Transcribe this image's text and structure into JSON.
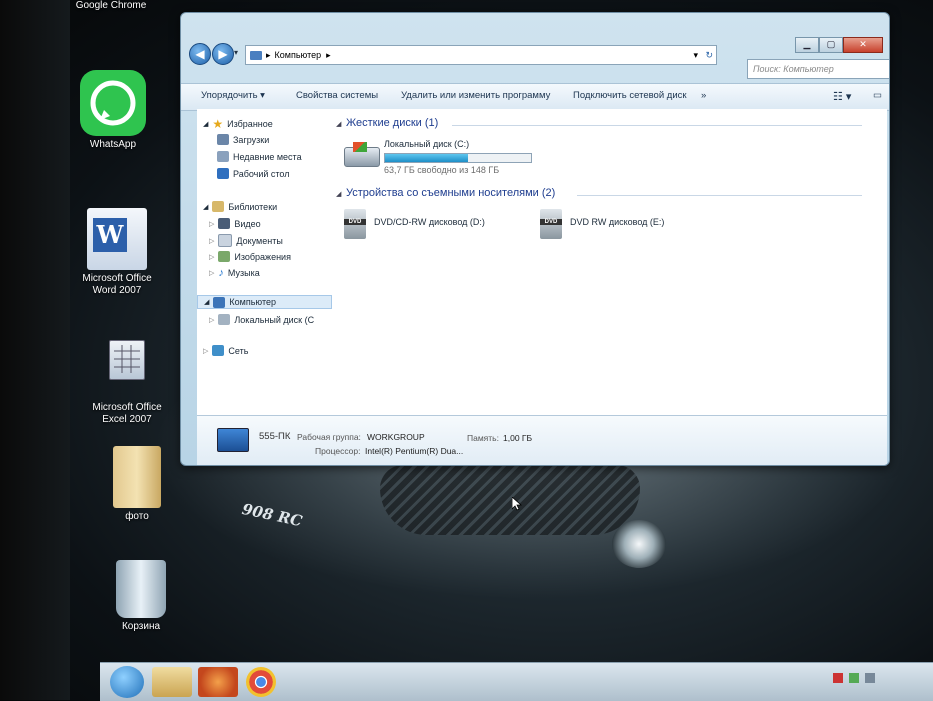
{
  "desktop": {
    "icons": [
      {
        "label": "Google Chrome"
      },
      {
        "label": "WhatsApp"
      },
      {
        "label": "Microsoft Office Word 2007"
      },
      {
        "label": "Microsoft Office Excel 2007"
      },
      {
        "label": "фото"
      },
      {
        "label": "Корзина"
      }
    ],
    "wallpaper_badge": "908 RC"
  },
  "explorer": {
    "address": {
      "crumb": "Компьютер",
      "separator": "▸"
    },
    "search_placeholder": "Поиск: Компьютер",
    "toolbar": {
      "organize": "Упорядочить ▾",
      "system_properties": "Свойства системы",
      "uninstall": "Удалить или изменить программу",
      "map_drive": "Подключить сетевой диск",
      "more": "»"
    },
    "nav": {
      "favorites": "Избранное",
      "downloads": "Загрузки",
      "recent": "Недавние места",
      "desktop": "Рабочий стол",
      "libraries": "Библиотеки",
      "video": "Видео",
      "documents": "Документы",
      "pictures": "Изображения",
      "music": "Музыка",
      "computer": "Компьютер",
      "local_disk": "Локальный диск (C",
      "network": "Сеть"
    },
    "groups": {
      "hard_disks": "Жесткие диски (1)",
      "removable": "Устройства со съемными носителями (2)"
    },
    "drives": {
      "c_name": "Локальный диск (C:)",
      "c_space": "63,7 ГБ свободно из 148 ГБ",
      "c_used_fraction": 0.57,
      "d_name": "DVD/CD-RW дисковод (D:)",
      "e_name": "DVD RW дисковод (E:)",
      "dvd_badge": "DVD"
    },
    "details": {
      "pc_name": "555-ПК",
      "workgroup_label": "Рабочая группа:",
      "workgroup_value": "WORKGROUP",
      "memory_label": "Память:",
      "memory_value": "1,00 ГБ",
      "cpu_label": "Процессор:",
      "cpu_value": "Intel(R) Pentium(R) Dua..."
    }
  },
  "colors": {
    "accent": "#1e3d8f",
    "progress": "#2aa6dc",
    "window_frame": "#b8d4e6"
  }
}
